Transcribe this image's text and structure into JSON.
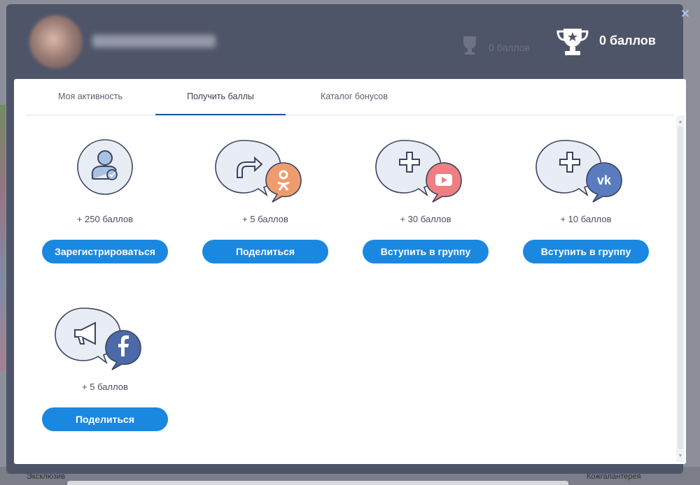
{
  "background": {
    "bottom_items": [
      "Эксклюзив",
      "Кожгалантерея"
    ]
  },
  "header": {
    "points_total": "0 баллов",
    "ghost_points": "0 баллов"
  },
  "tabs": [
    {
      "label": "Моя активность",
      "active": false
    },
    {
      "label": "Получить баллы",
      "active": true
    },
    {
      "label": "Каталог бонусов",
      "active": false
    }
  ],
  "cards": [
    {
      "points": "+ 250 баллов",
      "button": "Зарегистрироваться",
      "main_icon": "user-check-icon",
      "social_icon": null
    },
    {
      "points": "+ 5 баллов",
      "button": "Поделиться",
      "main_icon": "share-arrow-icon",
      "social_icon": "odnoklassniki-icon"
    },
    {
      "points": "+ 30 баллов",
      "button": "Вступить в группу",
      "main_icon": "plus-icon",
      "social_icon": "youtube-icon"
    },
    {
      "points": "+ 10 баллов",
      "button": "Вступить в группу",
      "main_icon": "plus-icon",
      "social_icon": "vk-icon"
    },
    {
      "points": "+ 5 баллов",
      "button": "Поделиться",
      "main_icon": "megaphone-icon",
      "social_icon": "facebook-icon"
    }
  ],
  "colors": {
    "button": "#1a88e0",
    "bubble_fill": "#e8edf5",
    "bubble_stroke": "#3a4460",
    "odnoklassniki": "#ee9c6e",
    "youtube": "#ef7f82",
    "vk": "#5a7cbf",
    "facebook": "#4c6aa8"
  }
}
